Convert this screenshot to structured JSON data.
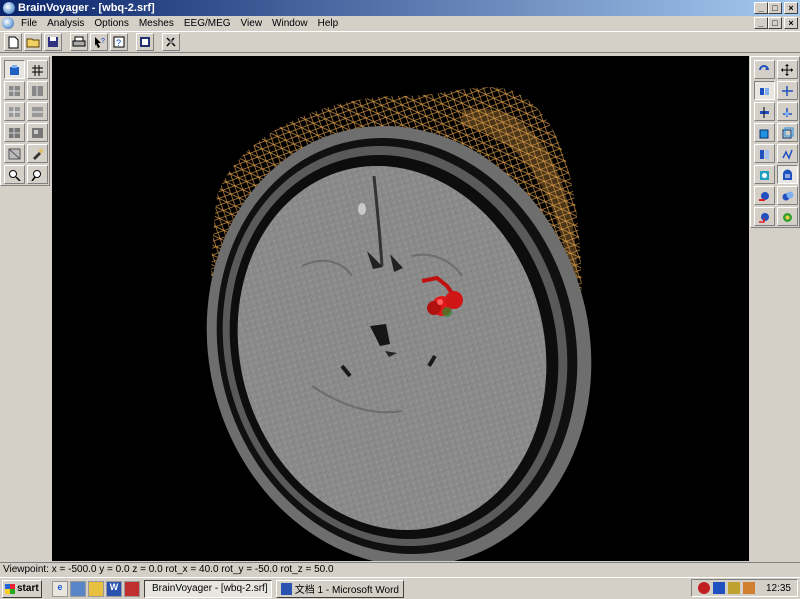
{
  "window": {
    "title": "BrainVoyager - [wbq-2.srf]"
  },
  "menu": {
    "items": [
      "File",
      "Analysis",
      "Options",
      "Meshes",
      "EEG/MEG",
      "View",
      "Window",
      "Help"
    ],
    "window_buttons": [
      "_",
      "□",
      "×"
    ]
  },
  "title_buttons": [
    "_",
    "□",
    "×"
  ],
  "toolbar": {
    "buttons": [
      "new-icon",
      "open-folder-icon",
      "save-icon",
      "print-icon",
      "help-arrow-icon",
      "context-help-icon",
      "export-icon",
      "settings-icon"
    ]
  },
  "left_palette": {
    "tools": [
      "select-tool-icon",
      "grid-icon",
      "layout-1-icon",
      "layout-2-icon",
      "layout-3-icon",
      "layout-4-icon",
      "layout-5-icon",
      "layout-6-icon",
      "mesh-tool-icon",
      "brush-icon",
      "zoom-in-icon",
      "zoom-out-icon"
    ]
  },
  "right_palette": {
    "tools": [
      "rotate-icon",
      "move-icon",
      "flip-icon",
      "pan-icon",
      "slice-icon",
      "axis-icon",
      "cube-icon",
      "cube-wire-icon",
      "frame-icon",
      "contour-icon",
      "head-icon",
      "head-mesh-icon",
      "head-side-icon",
      "head-rotate-icon",
      "head-color-icon",
      "head-alt-icon"
    ]
  },
  "status": {
    "text": "Viewpoint: x = -500.0  y = 0.0  z = 0.0  rot_x = 40.0  rot_y = -50.0  rot_z = 50.0"
  },
  "taskbar": {
    "start_label": "start",
    "tasks": [
      {
        "label": "BrainVoyager - [wbq-2.srf]",
        "active": true
      },
      {
        "label": "文档 1 - Microsoft Word",
        "active": false
      }
    ],
    "clock": "12:35"
  },
  "colors": {
    "title_start": "#0a246a",
    "title_end": "#a6caf0",
    "mesh": "#d89a48",
    "activation": "#e01818",
    "brain": "#8c8c8c"
  }
}
